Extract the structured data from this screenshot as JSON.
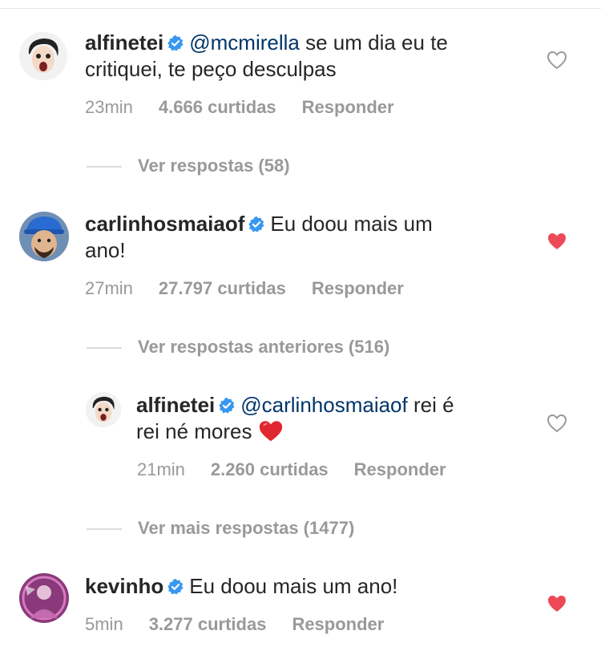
{
  "colors": {
    "liked": "#ed4956",
    "muted": "#999999",
    "mention": "#003569",
    "verified": "#3897f0"
  },
  "comments": [
    {
      "username": "alfinetei",
      "mention": "@mcmirella",
      "text_line1": " se um dia eu te",
      "text_line2": "critiquei, te peço desculpas",
      "time": "23min",
      "likes": "4.666 curtidas",
      "reply": "Responder",
      "liked": false
    },
    {
      "username": "carlinhosmaiaof",
      "mention": "",
      "text_line1": "Eu doou mais um",
      "text_line2": "ano!",
      "time": "27min",
      "likes": "27.797 curtidas",
      "reply": "Responder",
      "liked": true
    },
    {
      "username": "alfinetei",
      "mention": "@carlinhosmaiaof",
      "text_line1": " rei é",
      "text_line2": "rei né mores ",
      "emoji": "❤️",
      "time": "21min",
      "likes": "2.260 curtidas",
      "reply": "Responder",
      "liked": false
    },
    {
      "username": "kevinho",
      "mention": "",
      "text_line1": "Eu doou mais um ano!",
      "time": "5min",
      "likes": "3.277 curtidas",
      "reply": "Responder",
      "liked": true
    }
  ],
  "threads": {
    "view_replies": "Ver respostas (58)",
    "view_previous": "Ver respostas anteriores (516)",
    "view_more": "Ver mais respostas (1477)"
  },
  "icons": {
    "verified": "verified-badge-icon",
    "heart": "heart-icon"
  }
}
